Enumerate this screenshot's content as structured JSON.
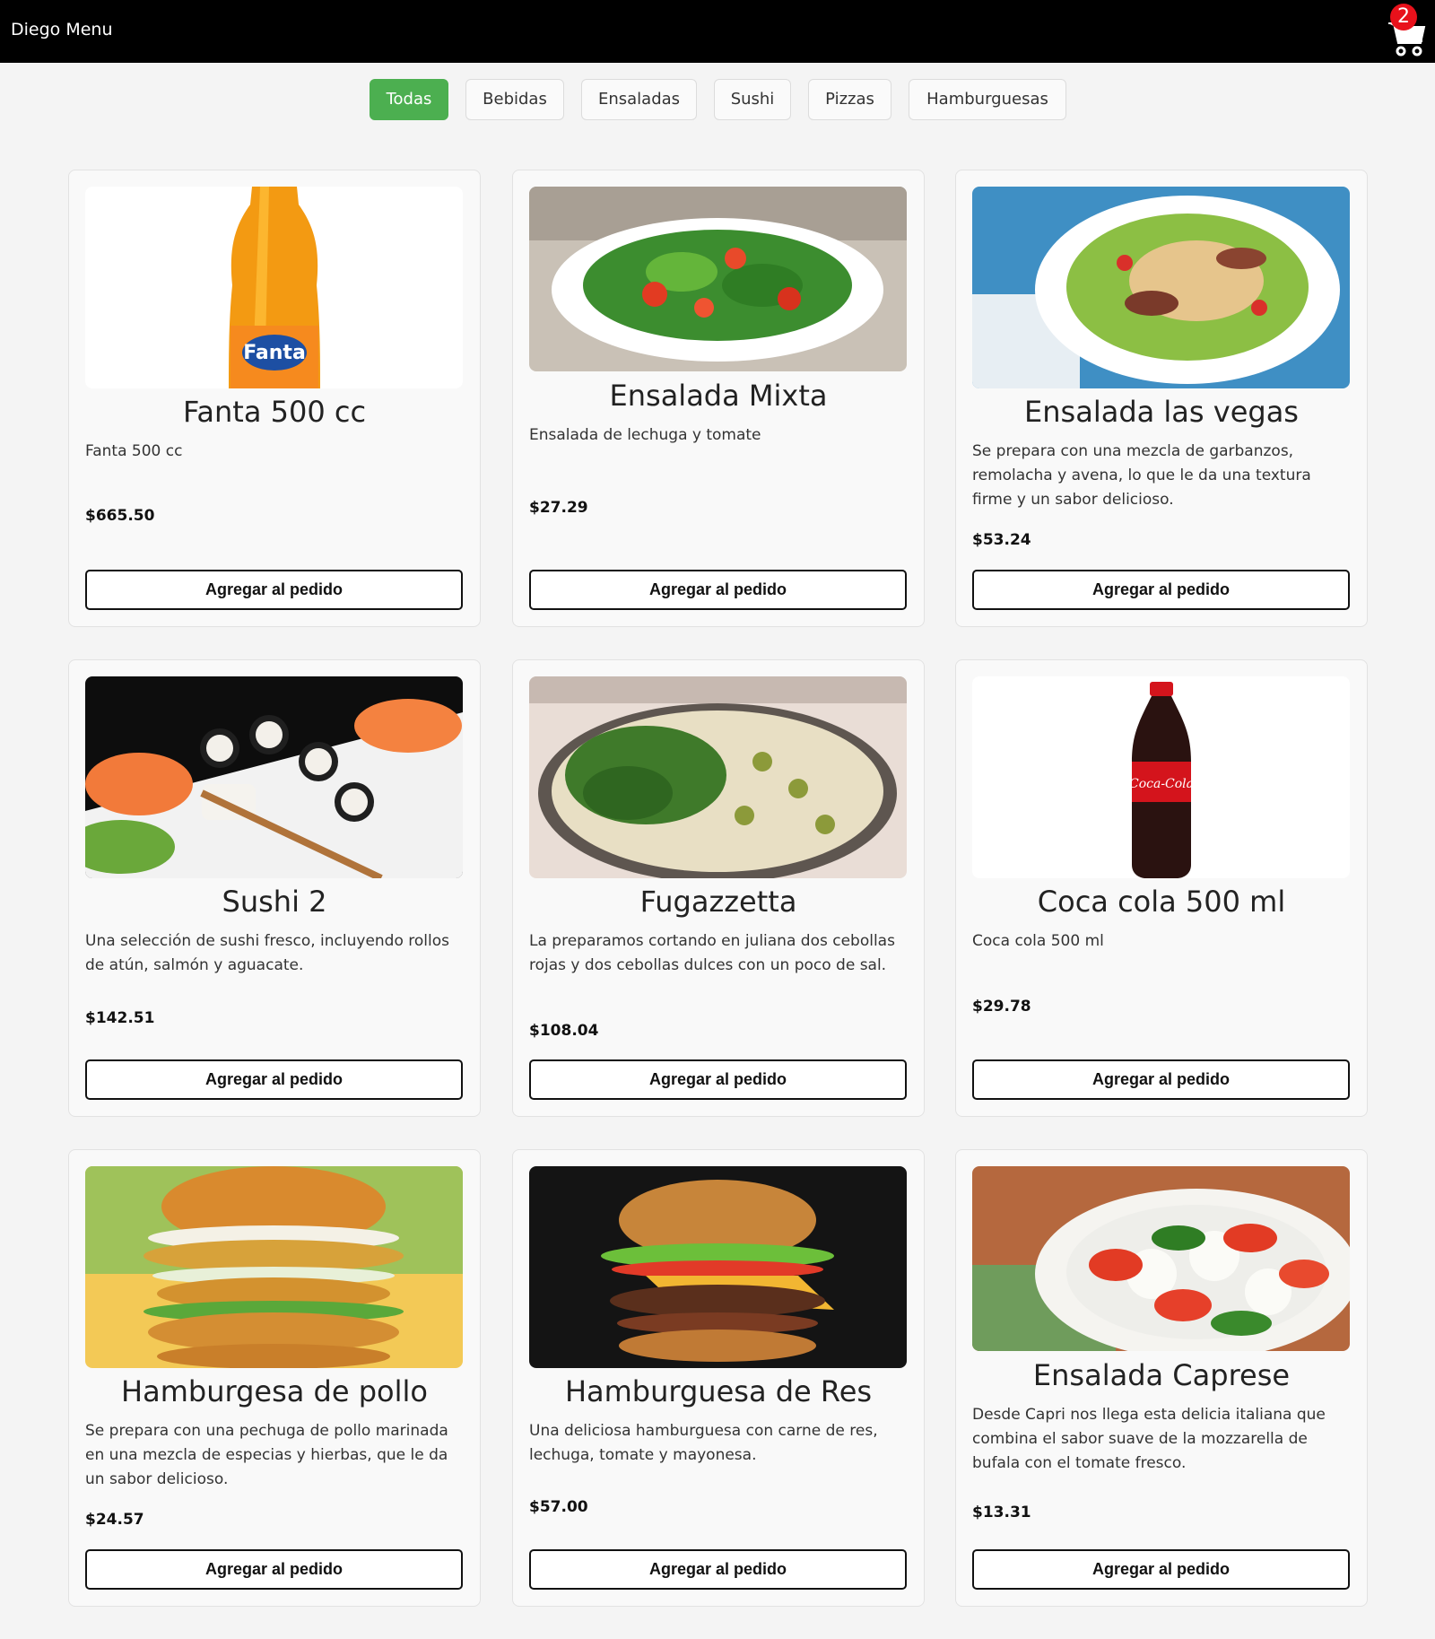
{
  "header": {
    "title": "Diego Menu",
    "cart_count": "2"
  },
  "filters": [
    "Todas",
    "Bebidas",
    "Ensaladas",
    "Sushi",
    "Pizzas",
    "Hamburguesas"
  ],
  "products": [
    {
      "name": "Fanta 500 cc",
      "description": "Fanta 500 cc",
      "price": "$665.50",
      "button": "Agregar al pedido",
      "image": "fanta-bottle"
    },
    {
      "name": "Ensalada Mixta",
      "description": "Ensalada de lechuga y tomate",
      "price": "$27.29",
      "button": "Agregar al pedido",
      "image": "mixed-salad"
    },
    {
      "name": "Ensalada las vegas",
      "description": "Se prepara con una mezcla de garbanzos, remolacha y avena, lo que le da una textura firme y un sabor delicioso.",
      "price": "$53.24",
      "button": "Agregar al pedido",
      "image": "chicken-salad"
    },
    {
      "name": "Sushi 2",
      "description": "Una selección de sushi fresco, incluyendo rollos de atún, salmón y aguacate.",
      "price": "$142.51",
      "button": "Agregar al pedido",
      "image": "sushi-platter"
    },
    {
      "name": "Fugazzetta",
      "description": "La preparamos cortando en juliana dos cebollas rojas y dos cebollas dulces con un poco de sal.",
      "price": "$108.04",
      "button": "Agregar al pedido",
      "image": "onion-pizza"
    },
    {
      "name": "Coca cola 500 ml",
      "description": "Coca cola 500 ml",
      "price": "$29.78",
      "button": "Agregar al pedido",
      "image": "coca-cola-bottle"
    },
    {
      "name": "Hamburgesa de pollo",
      "description": "Se prepara con una pechuga de pollo marinada en una mezcla de especias y hierbas, que le da un sabor delicioso.",
      "price": "$24.57",
      "button": "Agregar al pedido",
      "image": "chicken-burger"
    },
    {
      "name": "Hamburguesa de Res",
      "description": "Una deliciosa hamburguesa con carne de res, lechuga, tomate y mayonesa.",
      "price": "$57.00",
      "button": "Agregar al pedido",
      "image": "beef-burger"
    },
    {
      "name": "Ensalada Caprese",
      "description": "Desde Capri nos llega esta delicia italiana que combina el sabor suave de la mozzarella de bufala con el tomate fresco.",
      "price": "$13.31",
      "button": "Agregar al pedido",
      "image": "caprese-salad"
    }
  ],
  "colors": {
    "header_bg": "#000000",
    "active_filter": "#4caf50",
    "cart_badge": "#e8111b"
  }
}
